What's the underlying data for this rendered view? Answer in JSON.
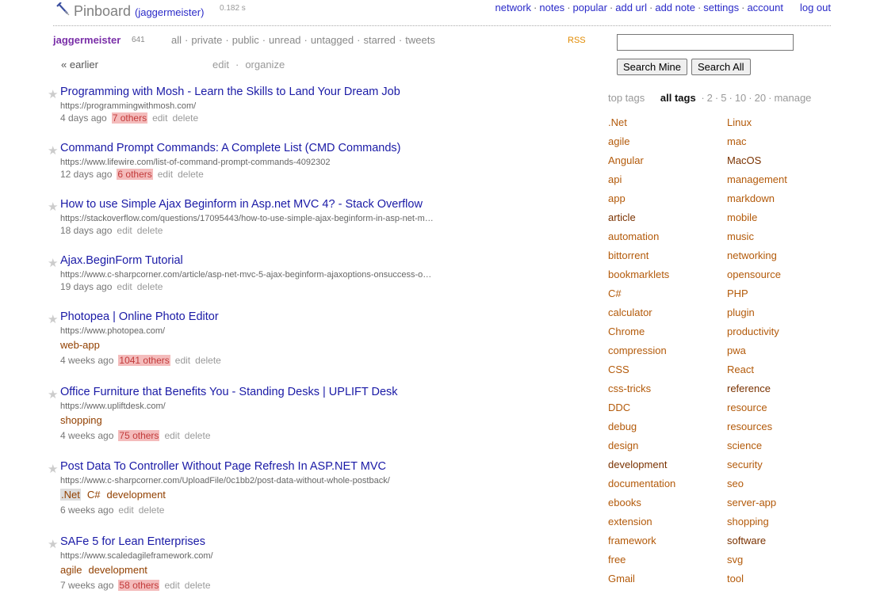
{
  "header": {
    "brand": "Pinboard",
    "user": "(jaggermeister)",
    "timing": "0.182 s",
    "nav": [
      "network",
      "notes",
      "popular",
      "add url",
      "add note",
      "settings",
      "account"
    ],
    "logout": "log out"
  },
  "subheader": {
    "username": "jaggermeister",
    "count": "641",
    "filters": [
      "all",
      "private",
      "public",
      "unread",
      "untagged",
      "starred",
      "tweets"
    ],
    "rss": "RSS",
    "earlier": "« earlier",
    "edit": "edit",
    "organize": "organize"
  },
  "search": {
    "value": "",
    "mine": "Search Mine",
    "all": "Search All"
  },
  "tagnav": {
    "top": "top tags",
    "all": "all tags",
    "counts": [
      "2",
      "5",
      "10",
      "20"
    ],
    "manage": "manage"
  },
  "bookmarks": [
    {
      "title": "Programming with Mosh - Learn the Skills to Land Your Dream Job",
      "url": "https://programmingwithmosh.com/",
      "tags": [],
      "age": "4 days ago",
      "others": "7 others",
      "edit": "edit",
      "delete": "delete"
    },
    {
      "title": "Command Prompt Commands: A Complete List (CMD Commands)",
      "url": "https://www.lifewire.com/list-of-command-prompt-commands-4092302",
      "tags": [],
      "age": "12 days ago",
      "others": "6 others",
      "edit": "edit",
      "delete": "delete"
    },
    {
      "title": "How to use Simple Ajax Beginform in Asp.net MVC 4? - Stack Overflow",
      "url": "https://stackoverflow.com/questions/17095443/how-to-use-simple-ajax-beginform-in-asp-net-m…",
      "tags": [],
      "age": "18 days ago",
      "others": "",
      "edit": "edit",
      "delete": "delete"
    },
    {
      "title": "Ajax.BeginForm Tutorial",
      "url": "https://www.c-sharpcorner.com/article/asp-net-mvc-5-ajax-beginform-ajaxoptions-onsuccess-o…",
      "tags": [],
      "age": "19 days ago",
      "others": "",
      "edit": "edit",
      "delete": "delete"
    },
    {
      "title": "Photopea | Online Photo Editor",
      "url": "https://www.photopea.com/",
      "tags": [
        "web-app"
      ],
      "age": "4 weeks ago",
      "others": "1041 others",
      "edit": "edit",
      "delete": "delete"
    },
    {
      "title": "Office Furniture that Benefits You - Standing Desks | UPLIFT Desk",
      "url": "https://www.upliftdesk.com/",
      "tags": [
        "shopping"
      ],
      "age": "4 weeks ago",
      "others": "75 others",
      "edit": "edit",
      "delete": "delete"
    },
    {
      "title": "Post Data To Controller Without Page Refresh In ASP.NET MVC",
      "url": "https://www.c-sharpcorner.com/UploadFile/0c1bb2/post-data-without-whole-postback/",
      "tags": [
        ".Net",
        "C#",
        "development"
      ],
      "age": "6 weeks ago",
      "others": "",
      "edit": "edit",
      "delete": "delete"
    },
    {
      "title": "SAFe 5 for Lean Enterprises",
      "url": "https://www.scaledagileframework.com/",
      "tags": [
        "agile",
        "development"
      ],
      "age": "7 weeks ago",
      "others": "58 others",
      "edit": "edit",
      "delete": "delete"
    }
  ],
  "tags_left": [
    ".Net",
    "agile",
    "Angular",
    "api",
    "app",
    "article",
    "automation",
    "bittorrent",
    "bookmarklets",
    "C#",
    "calculator",
    "Chrome",
    "compression",
    "CSS",
    "css-tricks",
    "DDC",
    "debug",
    "design",
    "development",
    "documentation",
    "ebooks",
    "extension",
    "framework",
    "free",
    "Gmail"
  ],
  "tags_right": [
    "Linux",
    "mac",
    "MacOS",
    "management",
    "markdown",
    "mobile",
    "music",
    "networking",
    "opensource",
    "PHP",
    "plugin",
    "productivity",
    "pwa",
    "React",
    "reference",
    "resource",
    "resources",
    "science",
    "security",
    "seo",
    "server-app",
    "shopping",
    "software",
    "svg",
    "tool"
  ],
  "colors": {
    "link": "#1a1aa6",
    "tag": "#b35a0a",
    "others_bg": "#f4bcbc"
  }
}
